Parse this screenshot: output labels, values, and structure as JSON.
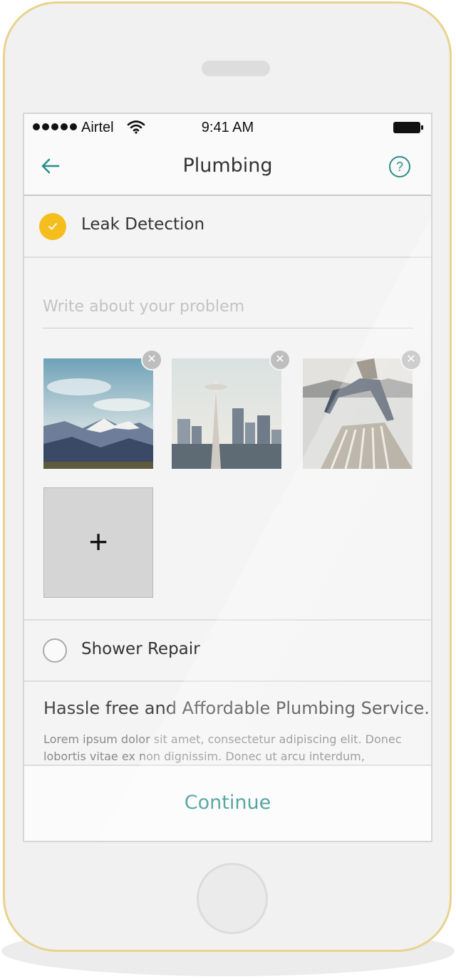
{
  "status_bar": {
    "signal_icon": "signal-dots-icon",
    "carrier": "Airtel",
    "wifi_icon": "wifi-icon",
    "time": "9:41 AM",
    "battery_icon": "battery-icon"
  },
  "header": {
    "back_icon": "arrow-left-icon",
    "title": "Plumbing",
    "help_label": "?",
    "accent_color": "#2a8e8a"
  },
  "services": [
    {
      "label": "Leak Detection",
      "selected": true
    },
    {
      "label": "Shower Repair",
      "selected": false
    }
  ],
  "problem": {
    "placeholder": "Write about your problem",
    "value": ""
  },
  "photos": [
    {
      "subject": "mountain landscape"
    },
    {
      "subject": "city skyline with tower"
    },
    {
      "subject": "person jumping on pier"
    }
  ],
  "add_photo_label": "+",
  "remove_photo_label": "✕",
  "info": {
    "tagline": "Hassle free and Affordable Plumbing Service.",
    "description": "Lorem ipsum dolor sit amet, consectetur adipiscing elit. Donec lobortis vitae ex non dignissim. Donec ut arcu interdum, consequat nunc ut,"
  },
  "footer": {
    "continue_label": "Continue"
  },
  "colors": {
    "selected_check": "#f5bd1d",
    "frame_gold": "#e8d38e"
  }
}
